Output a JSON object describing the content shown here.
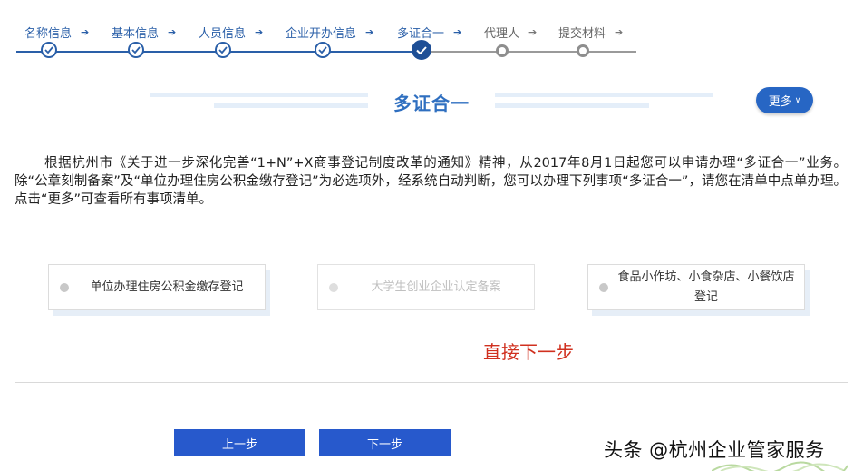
{
  "stepper": {
    "steps": [
      {
        "label": "名称信息",
        "status": "done"
      },
      {
        "label": "基本信息",
        "status": "done"
      },
      {
        "label": "人员信息",
        "status": "done"
      },
      {
        "label": "企业开办信息",
        "status": "done"
      },
      {
        "label": "多证合一",
        "status": "current"
      },
      {
        "label": "代理人",
        "status": "todo"
      },
      {
        "label": "提交材料",
        "status": "todo"
      }
    ]
  },
  "section": {
    "title": "多证合一",
    "more_label": "更多",
    "more_icon": "chevron-down-icon"
  },
  "intro": {
    "text": "根据杭州市《关于进一步深化完善“1+N”+X商事登记制度改革的通知》精神，从2017年8月1日起您可以申请办理“多证合一”业务。除“公章刻制备案”及“单位办理住房公积金缴存登记”为必选项外，经系统自动判断，您可以办理下列事项“多证合一”，请您在清单中点单办理。点击“更多”可查看所有事项清单。"
  },
  "options": [
    {
      "label": "单位办理住房公积金缴存登记",
      "enabled": true
    },
    {
      "label": "大学生创业企业认定备案",
      "enabled": false
    },
    {
      "label": "食品小作坊、小食杂店、小餐饮店登记",
      "enabled": true
    }
  ],
  "annotation": {
    "text": "直接下一步",
    "color": "#d0301f"
  },
  "buttons": {
    "prev_label": "上一步",
    "next_label": "下一步"
  },
  "watermark": {
    "text": "头条 @杭州企业管家服务"
  },
  "colors": {
    "primary": "#2759cc",
    "step_done": "#2a5fa8",
    "step_todo": "#8e8e8e",
    "title": "#2f6fc0"
  }
}
